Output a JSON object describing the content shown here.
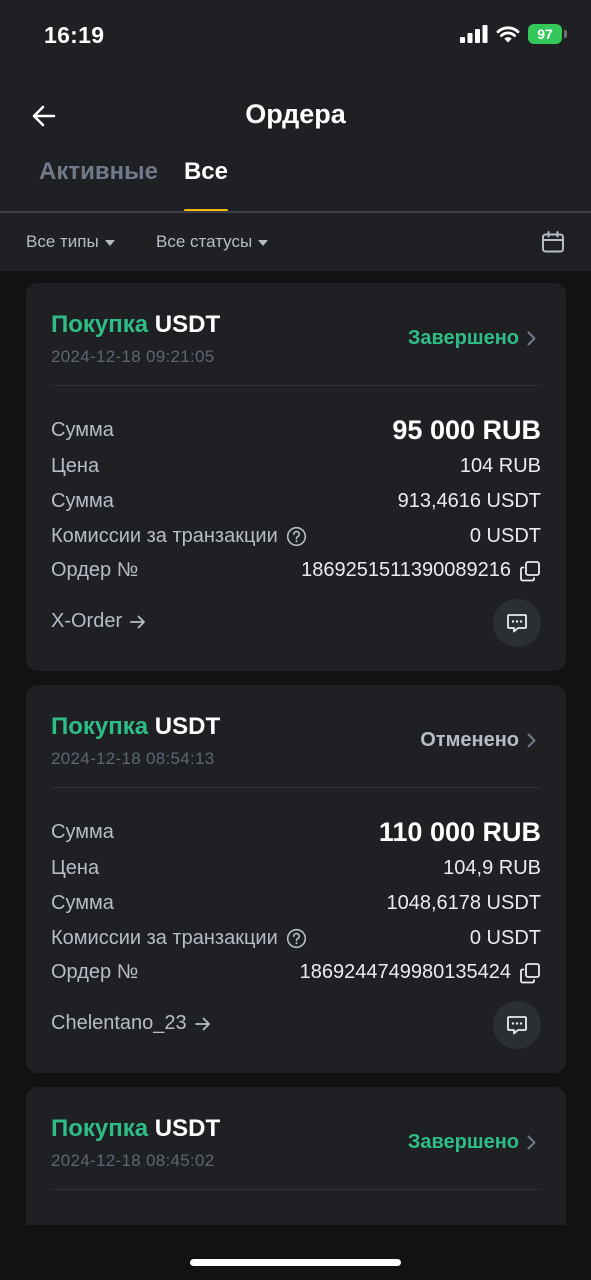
{
  "status_bar": {
    "time": "16:19",
    "battery": "97"
  },
  "header": {
    "title": "Ордера"
  },
  "tabs": [
    {
      "label": "Активные",
      "active": false
    },
    {
      "label": "Все",
      "active": true
    }
  ],
  "filters": {
    "types": "Все типы",
    "statuses": "Все статусы"
  },
  "colors": {
    "accent": "#f0b90b",
    "buy": "#2ebd85",
    "completed": "#2ebd85",
    "cancelled": "#b7bdc6"
  },
  "labels": {
    "amount": "Сумма",
    "price": "Цена",
    "quantity": "Сумма",
    "fees": "Комиссии за транзакции",
    "order_no": "Ордер №"
  },
  "orders": [
    {
      "side": "Покупка",
      "asset": "USDT",
      "date": "2024-12-18 09:21:05",
      "status": "Завершено",
      "amount": "95 000 RUB",
      "price": "104 RUB",
      "quantity": "913,4616 USDT",
      "fee": "0 USDT",
      "order_id": "1869251511390089216",
      "merchant": "X-Order"
    },
    {
      "side": "Покупка",
      "asset": "USDT",
      "date": "2024-12-18 08:54:13",
      "status": "Отменено",
      "amount": "110 000 RUB",
      "price": "104,9 RUB",
      "quantity": "1048,6178 USDT",
      "fee": "0 USDT",
      "order_id": "1869244749980135424",
      "merchant": "Chelentano_23"
    },
    {
      "side": "Покупка",
      "asset": "USDT",
      "date": "2024-12-18 08:45:02",
      "status": "Завершено",
      "amount": "",
      "price": "",
      "quantity": "",
      "fee": "",
      "order_id": "",
      "merchant": ""
    }
  ]
}
